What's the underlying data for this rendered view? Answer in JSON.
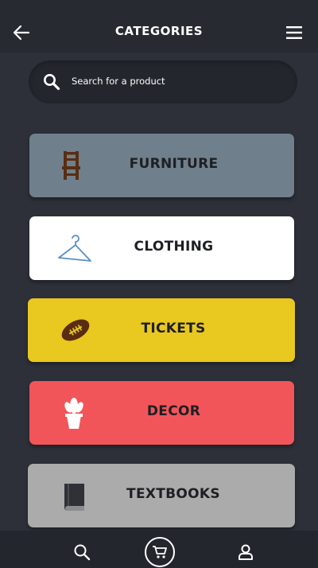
{
  "header": {
    "title": "CATEGORIES"
  },
  "search": {
    "placeholder": "Search for a product"
  },
  "categories": [
    {
      "label": "FURNITURE",
      "icon": "chair-icon",
      "color": "#6f808c"
    },
    {
      "label": "CLOTHING",
      "icon": "hanger-icon",
      "color": "#ffffff"
    },
    {
      "label": "TICKETS",
      "icon": "football-icon",
      "color": "#e9c81f"
    },
    {
      "label": "DECOR",
      "icon": "plant-icon",
      "color": "#f25559"
    },
    {
      "label": "TEXTBOOKS",
      "icon": "book-icon",
      "color": "#ababab"
    }
  ],
  "tabbar": {
    "items": [
      "search-icon",
      "cart-icon",
      "profile-icon"
    ]
  }
}
